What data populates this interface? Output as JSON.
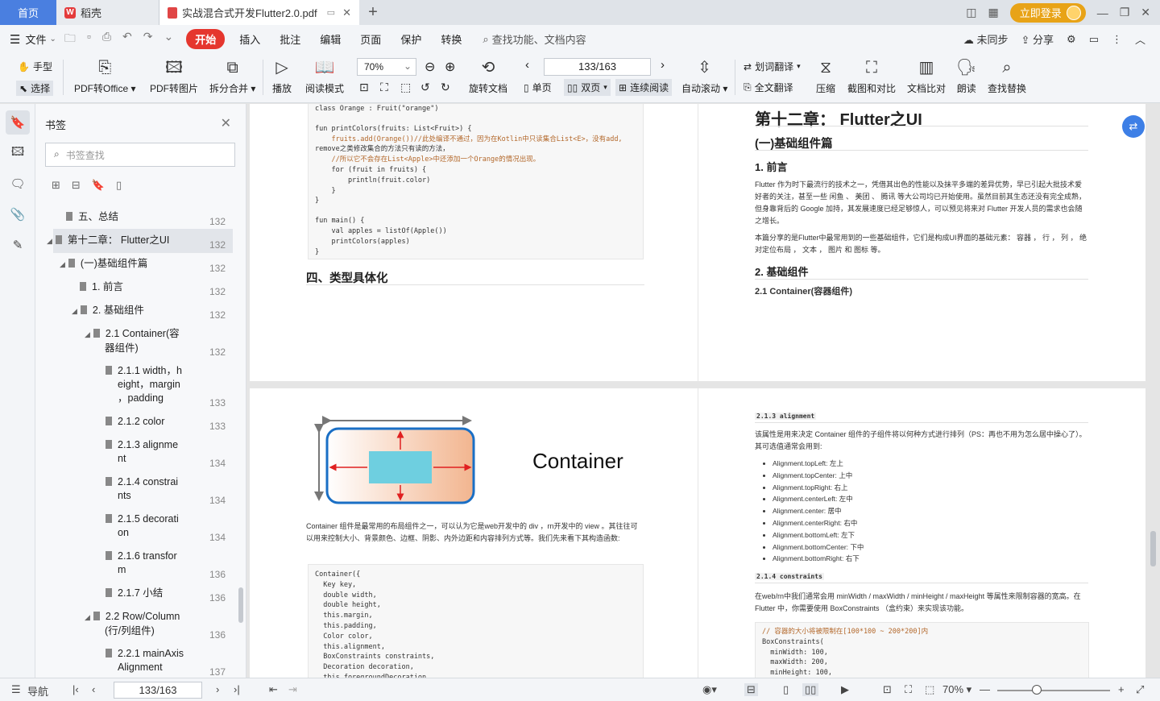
{
  "tabs": {
    "home": "首页",
    "daoke": "稻壳",
    "active_doc": "实战混合式开发Flutter2.0.pdf",
    "login": "立即登录"
  },
  "menu": {
    "file": "文件",
    "start": "开始",
    "items": [
      "插入",
      "批注",
      "编辑",
      "页面",
      "保护",
      "转换"
    ],
    "search": "查找功能、文档内容",
    "unsynced": "未同步",
    "share": "分享"
  },
  "ribbon": {
    "hand": "手型",
    "select": "选择",
    "pdf_to_office": "PDF转Office",
    "pdf_to_image": "PDF转图片",
    "split_merge": "拆分合并",
    "play": "播放",
    "read_mode": "阅读模式",
    "zoom": "70%",
    "page": "133/163",
    "rotate": "旋转文档",
    "single": "单页",
    "double": "双页",
    "continuous": "连续阅读",
    "auto_scroll": "自动滚动",
    "word_translate": "划词翻译",
    "full_translate": "全文翻译",
    "compress": "压缩",
    "screenshot_compare": "截图和对比",
    "doc_compare": "文档比对",
    "read_aloud": "朗读",
    "find_replace": "查找替换"
  },
  "bookmarks": {
    "title": "书签",
    "search_placeholder": "书签查找",
    "items": [
      {
        "label": "五、总结",
        "page": "132"
      },
      {
        "label": "第十二章： Flutter之UI",
        "page": "132"
      },
      {
        "label": "(一)基础组件篇",
        "page": "132"
      },
      {
        "label": "1. 前言",
        "page": "132"
      },
      {
        "label": "2. 基础组件",
        "page": "132"
      },
      {
        "label": "2.1 Container(容",
        "label2": "器组件)",
        "page": "132"
      },
      {
        "label": "2.1.1 width，h",
        "label2": "eight，margin",
        "label3": "，padding",
        "page": "133"
      },
      {
        "label": "2.1.2 color",
        "page": "133"
      },
      {
        "label": "2.1.3 alignme",
        "label2": "nt",
        "page": "134"
      },
      {
        "label": "2.1.4 constrai",
        "label2": "nts",
        "page": "134"
      },
      {
        "label": "2.1.5 decorati",
        "label2": "on",
        "page": "134"
      },
      {
        "label": "2.1.6 transfor",
        "label2": "m",
        "page": "136"
      },
      {
        "label": "2.1.7 小结",
        "page": "136"
      },
      {
        "label": "2.2 Row/Column",
        "label2": "(行/列组件)",
        "page": "136"
      },
      {
        "label": "2.2.1 mainAxis",
        "label2": "Alignment",
        "page": "137"
      }
    ]
  },
  "page_left_top": {
    "code": [
      "class Orange : Fruit(\"orange\")",
      "",
      "fun printColors(fruits: List<Fruit>) {",
      "    fruits.add(Orange())//此处编译不通过，因为在Kotlin中只读集合List<E>，没有add,",
      "remove之类修改集合的方法只有读的方法，",
      "    //所以它不会存在List<Apple>中还添加一个Orange的情况出现。",
      "    for (fruit in fruits) {",
      "        println(fruit.color)",
      "    }",
      "}",
      "",
      "fun main() {",
      "    val apples = listOf(Apple())",
      "    printColors(apples)",
      "}"
    ],
    "heading": "四、类型具体化"
  },
  "page_right_top": {
    "chapter": "第十二章： Flutter之UI",
    "section": "(一)基础组件篇",
    "h_preface": "1. 前言",
    "p1": "Flutter 作为时下最流行的技术之一，凭借其出色的性能以及抹平多端的差异优势，早已引起大批技术爱好者的关注，甚至一些 闲鱼 、 美团 、 腾讯 等大公司均已开始使用。虽然目前其生态还没有完全成熟，但身靠背后的 Google 加持，其发展速度已经足够惊人，可以预见将来对 Flutter 开发人员的需求也会随之增长。",
    "p2": "本篇分享的是Flutter中最常用到的一些基础组件，它们是构成UI界面的基础元素： 容器 ， 行 ， 列 ， 绝对定位布局 ， 文本 ， 图片 和 图标 等。",
    "h_basic": "2. 基础组件",
    "h_container": "2.1 Container(容器组件)"
  },
  "page_left_bottom": {
    "diagram_label": "Container",
    "p1": "Container 组件是最常用的布局组件之一，可以认为它是web开发中的 div ，rn开发中的 view 。其往往可以用来控制大小、背景颜色、边框、阴影、内外边距和内容排列方式等。我们先来看下其构造函数:",
    "code": [
      "Container({",
      "  Key key,",
      "  double width,",
      "  double height,",
      "  this.margin,",
      "  this.padding,",
      "  Color color,",
      "  this.alignment,",
      "  BoxConstraints constraints,",
      "  Decoration decoration,",
      "  this.foregroundDecoration,"
    ]
  },
  "page_right_bottom": {
    "h_alignment": "2.1.3 alignment",
    "p_alignment": "该属性是用来决定 Container 组件的子组件将以何种方式进行排列（PS：再也不用为怎么居中操心了）。其可选值通常会用到:",
    "align_items": [
      "Alignment.topLeft: 左上",
      "Alignment.topCenter: 上中",
      "Alignment.topRight: 右上",
      "Alignment.centerLeft: 左中",
      "Alignment.center: 居中",
      "Alignment.centerRight: 右中",
      "Alignment.bottomLeft: 左下",
      "Alignment.bottomCenter: 下中",
      "Alignment.bottomRight: 右下"
    ],
    "h_constraints": "2.1.4 constraints",
    "p_constraints": "在web/rn中我们通常会用 minWidth / maxWidth / minHeight / maxHeight 等属性来限制容器的宽高。在 Flutter 中，你需要使用 BoxConstraints （盒约束）来实现该功能。",
    "code": [
      "// 容器的大小将被限制在[100*100 ~ 200*200]内",
      "BoxConstraints(",
      "  minWidth: 100,",
      "  maxWidth: 200,",
      "  minHeight: 100,"
    ]
  },
  "status": {
    "nav": "导航",
    "page": "133/163",
    "zoom": "70%"
  }
}
